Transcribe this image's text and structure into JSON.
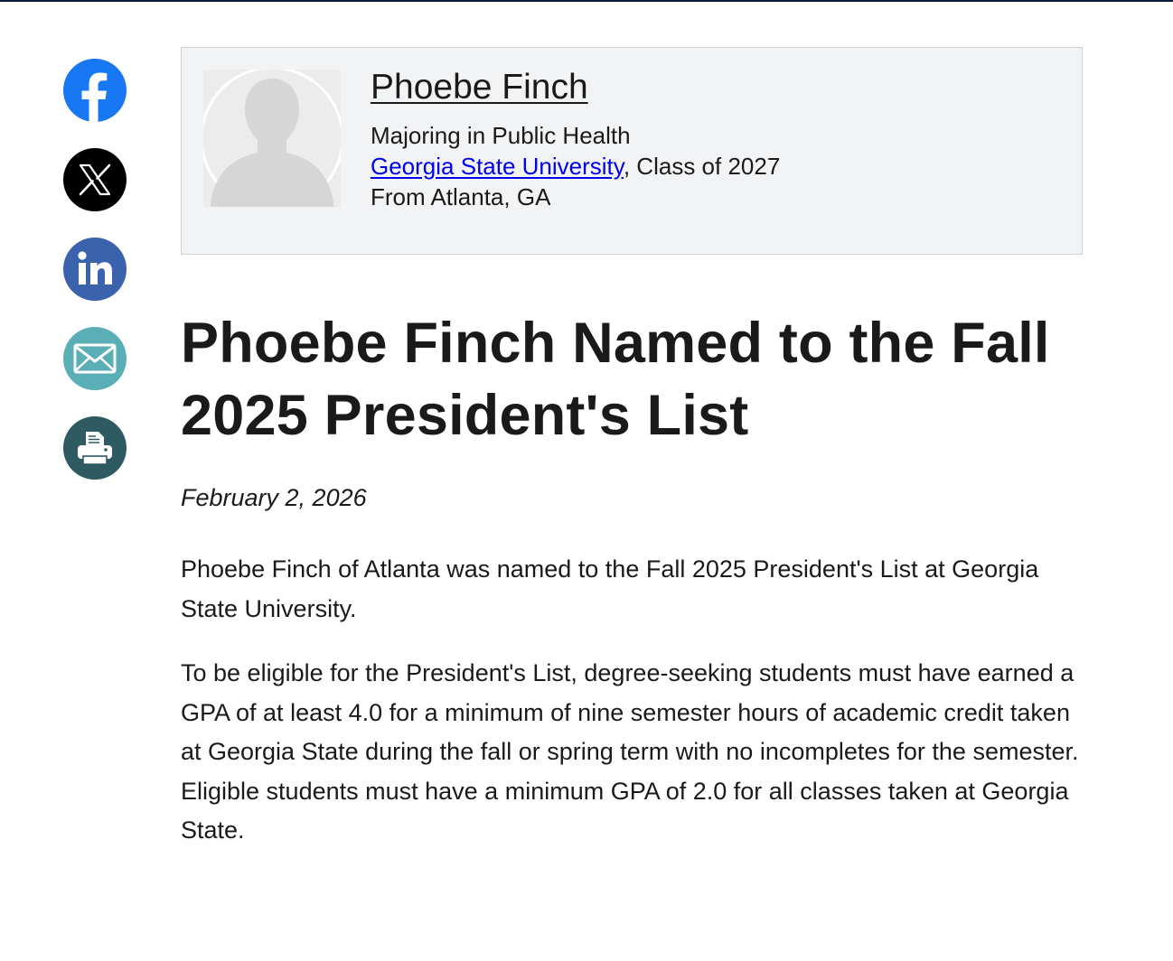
{
  "share": {
    "buttons": [
      {
        "name": "facebook",
        "color": "#1877f2",
        "icon": "facebook-icon"
      },
      {
        "name": "x",
        "color": "#000000",
        "icon": "x-icon"
      },
      {
        "name": "linkedin",
        "color": "#3b62ad",
        "icon": "linkedin-icon"
      },
      {
        "name": "email",
        "color": "#5aaeb6",
        "icon": "envelope-icon"
      },
      {
        "name": "print",
        "color": "#2e5a62",
        "icon": "printer-icon"
      }
    ]
  },
  "profile": {
    "name": "Phoebe Finch",
    "major": "Majoring in Public Health",
    "university": "Georgia State University",
    "class_suffix": ", Class of 2027",
    "hometown": "From Atlanta, GA"
  },
  "article": {
    "title": "Phoebe Finch Named to the Fall 2025 President's List",
    "date": "February 2, 2026",
    "paragraphs": [
      "Phoebe Finch of Atlanta was named to the Fall 2025 President's List at Georgia State University.",
      "To be eligible for the President's List, degree-seeking students must have earned a GPA of at least 4.0 for a minimum of nine semester hours of academic credit taken at Georgia State during the fall or spring term with no incompletes for the semester. Eligible students must have a minimum GPA of 2.0 for all classes taken at Georgia State."
    ]
  },
  "colors": {
    "link": "#0000ee",
    "card_background": "#f2f3f5",
    "top_rule": "#0d1b3a"
  }
}
